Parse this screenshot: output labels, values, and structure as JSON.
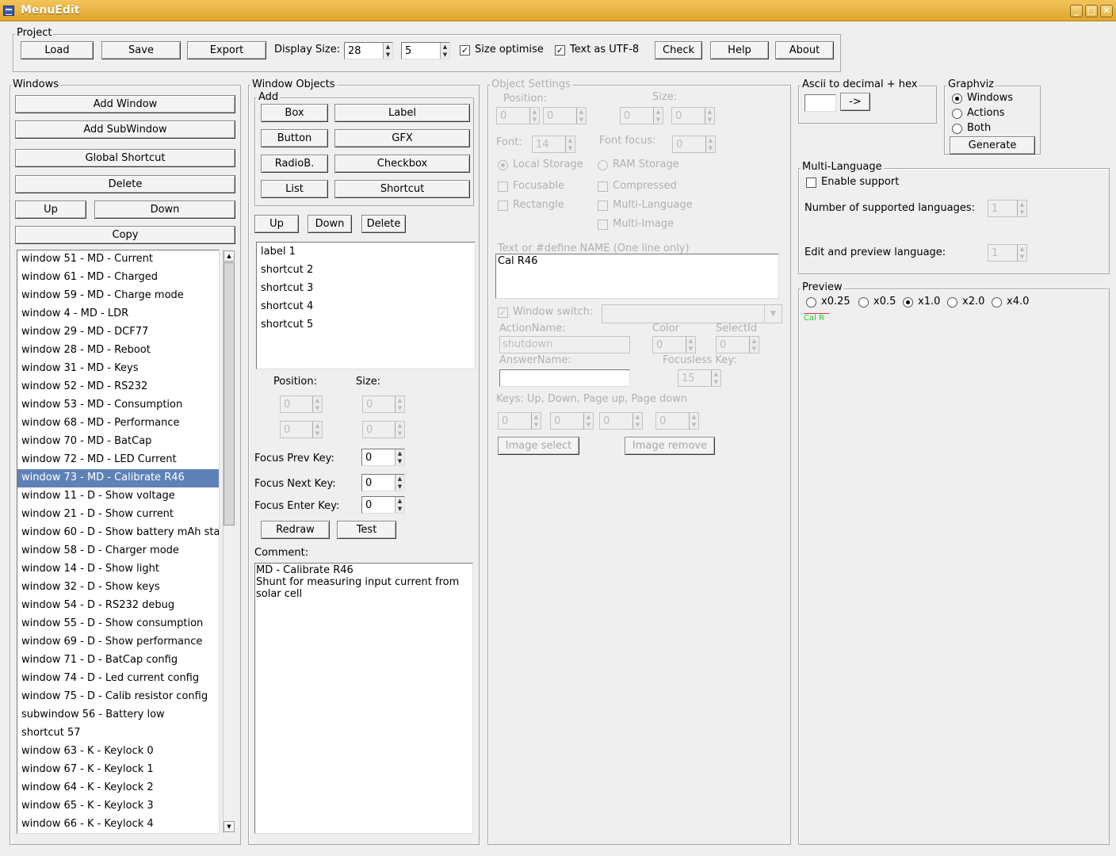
{
  "title": "MenuEdit",
  "project": {
    "label": "Project",
    "load": "Load",
    "save": "Save",
    "export": "Export",
    "display_size_label": "Display Size:",
    "display_w": "28",
    "display_h": "5",
    "size_optimise": "Size optimise",
    "size_optimise_checked": true,
    "utf8": "Text as UTF-8",
    "utf8_checked": true,
    "check": "Check",
    "help": "Help",
    "about": "About"
  },
  "windows": {
    "label": "Windows",
    "add_window": "Add Window",
    "add_subwindow": "Add SubWindow",
    "global_shortcut": "Global Shortcut",
    "delete": "Delete",
    "up": "Up",
    "down": "Down",
    "copy": "Copy",
    "selected_index": 12,
    "items": [
      "window 51 - MD - Current",
      "window 61 - MD - Charged",
      "window 59 - MD - Charge mode",
      "window 4 - MD - LDR",
      "window 29 - MD - DCF77",
      "window 28 - MD - Reboot",
      "window 31 - MD - Keys",
      "window 52 - MD - RS232",
      "window 53 - MD - Consumption",
      "window 68 - MD - Performance",
      "window 70 - MD - BatCap",
      "window 72 - MD - LED Current",
      "window 73 - MD - Calibrate R46",
      "window 11 - D - Show voltage",
      "window 21 - D - Show current",
      "window 60 - D - Show battery mAh sta",
      "window 58 - D - Charger mode",
      "window 14 - D - Show light",
      "window 32 - D - Show keys",
      "window 54 - D - RS232 debug",
      "window 55 - D - Show consumption",
      "window 69 - D - Show performance",
      "window 71 - D - BatCap config",
      "window 74 - D - Led current config",
      "window 75 - D - Calib resistor config",
      "subwindow 56 - Battery low",
      "shortcut 57",
      "window 63 - K - Keylock 0",
      "window 67 - K - Keylock 1",
      "window 64 - K - Keylock 2",
      "window 65 - K - Keylock 3",
      "window 66 - K - Keylock 4"
    ]
  },
  "objects": {
    "label": "Window Objects",
    "add_label": "Add",
    "box": "Box",
    "label_btn": "Label",
    "button": "Button",
    "gfx": "GFX",
    "radiob": "RadioB.",
    "checkbox": "Checkbox",
    "list": "List",
    "shortcut": "Shortcut",
    "up": "Up",
    "down": "Down",
    "delete": "Delete",
    "items": [
      "label 1",
      "shortcut 2",
      "shortcut 3",
      "shortcut 4",
      "shortcut 5"
    ],
    "position_label": "Position:",
    "size_label": "Size:",
    "pos_x": "0",
    "pos_y": "0",
    "size_w": "0",
    "size_h": "0",
    "focus_prev_label": "Focus Prev Key:",
    "focus_prev": "0",
    "focus_next_label": "Focus Next Key:",
    "focus_next": "0",
    "focus_enter_label": "Focus Enter Key:",
    "focus_enter": "0",
    "redraw": "Redraw",
    "test": "Test",
    "comment_label": "Comment:",
    "comment_lines": [
      "MD - Calibrate R46",
      "Shunt for measuring input current from",
      "solar cell"
    ]
  },
  "settings": {
    "label": "Object Settings",
    "position_label": "Position:",
    "size_label": "Size:",
    "pos_x": "0",
    "pos_y": "0",
    "size_w": "0",
    "size_h": "0",
    "font_label": "Font:",
    "font": "14",
    "font_focus_label": "Font focus:",
    "font_focus": "0",
    "local_storage": "Local Storage",
    "ram_storage": "RAM Storage",
    "focusable": "Focusable",
    "compressed": "Compressed",
    "rectangle": "Rectangle",
    "multi_language": "Multi-Language",
    "multi_image": "Multi-Image",
    "text_label": "Text or #define NAME (One line only)",
    "text_value": "Cal R46",
    "window_switch": "Window switch:",
    "action_name_label": "ActionName:",
    "action_name": "shutdown",
    "color_label": "Color",
    "color": "0",
    "select_id_label": "SelectId",
    "select_id": "0",
    "answer_name_label": "AnswerName:",
    "answer_name": "",
    "focusless_label": "Focusless Key:",
    "focusless": "15",
    "keys_label": "Keys: Up, Down, Page up, Page down",
    "key_up": "0",
    "key_down": "0",
    "key_pgup": "0",
    "key_pgdn": "0",
    "image_select": "Image select",
    "image_remove": "Image remove"
  },
  "ascii": {
    "label": "Ascii to decimal + hex",
    "input": "",
    "convert": "->"
  },
  "graphviz": {
    "label": "Graphviz",
    "windows": "Windows",
    "actions": "Actions",
    "both": "Both",
    "generate": "Generate"
  },
  "multilang": {
    "label": "Multi-Language",
    "enable": "Enable support",
    "num_label": "Number of supported languages:",
    "num": "1",
    "edit_label": "Edit and preview language:",
    "edit": "1"
  },
  "preview": {
    "label": "Preview",
    "zooms": [
      "x0.25",
      "x0.5",
      "x1.0",
      "x2.0",
      "x4.0"
    ],
    "selected_zoom": 2,
    "preview_text": "Cal R",
    "preview_color": "#22cc22"
  }
}
